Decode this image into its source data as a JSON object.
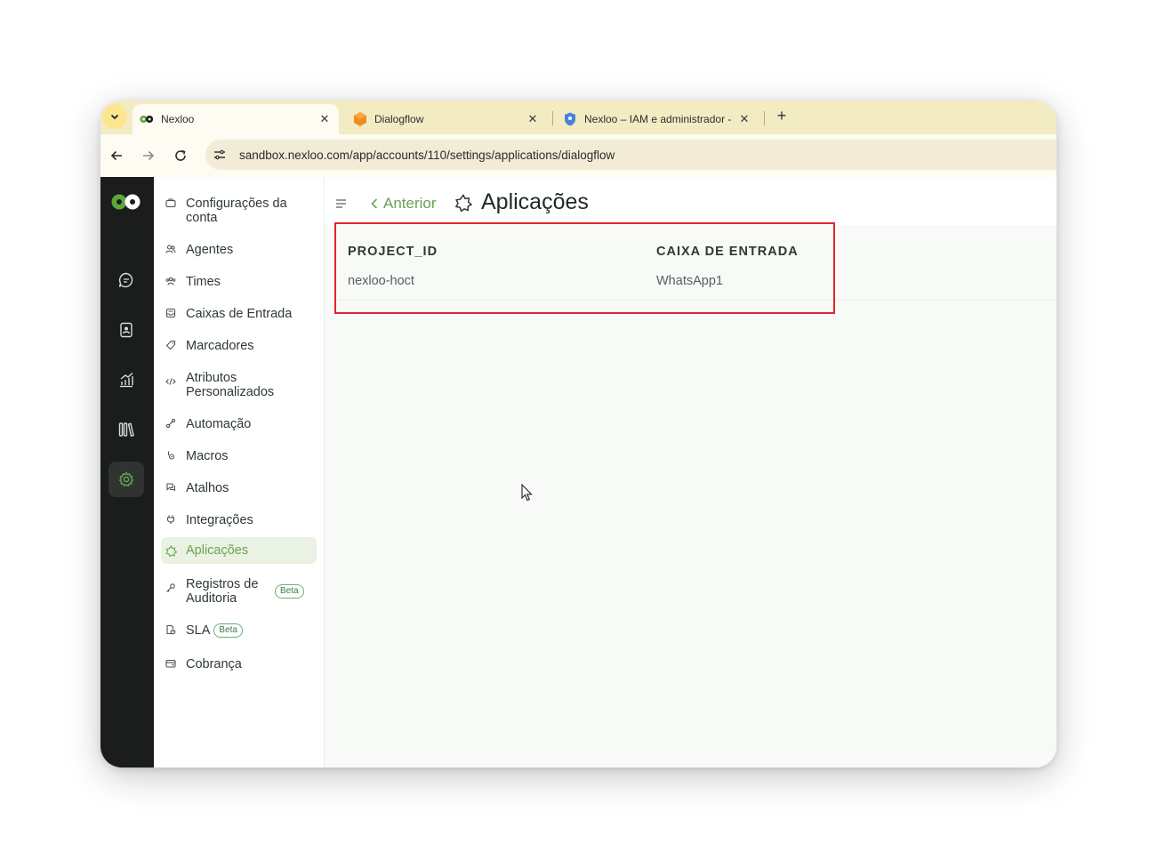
{
  "browser": {
    "tabs": [
      {
        "title": "Nexloo",
        "active": true,
        "favicon": "nexloo-logo-icon"
      },
      {
        "title": "Dialogflow",
        "active": false,
        "favicon": "dialogflow-icon"
      },
      {
        "title": "Nexloo – IAM e administrador -",
        "active": false,
        "favicon": "shield-icon"
      }
    ],
    "url": "sandbox.nexloo.com/app/accounts/110/settings/applications/dialogflow"
  },
  "rail": {
    "items": [
      "chat-icon",
      "contacts-icon",
      "reports-icon",
      "library-icon",
      "settings-gear-icon"
    ],
    "active": "settings-gear-icon"
  },
  "settings_nav": {
    "items": [
      {
        "label": "Configurações da conta",
        "icon": "briefcase-icon"
      },
      {
        "label": "Agentes",
        "icon": "users-icon"
      },
      {
        "label": "Times",
        "icon": "team-icon"
      },
      {
        "label": "Caixas de Entrada",
        "icon": "inbox-icon"
      },
      {
        "label": "Marcadores",
        "icon": "tag-icon"
      },
      {
        "label": "Atributos Personalizados",
        "icon": "code-icon"
      },
      {
        "label": "Automação",
        "icon": "automation-icon"
      },
      {
        "label": "Macros",
        "icon": "macro-icon"
      },
      {
        "label": "Atalhos",
        "icon": "chat-bubbles-icon"
      },
      {
        "label": "Integrações",
        "icon": "plug-icon"
      },
      {
        "label": "Aplicações",
        "icon": "star-badge-icon",
        "active": true
      },
      {
        "label": "Registros de Auditoria",
        "icon": "key-icon",
        "badge": "Beta"
      },
      {
        "label": "SLA",
        "icon": "document-clock-icon",
        "badge": "Beta"
      },
      {
        "label": "Cobrança",
        "icon": "wallet-icon"
      }
    ]
  },
  "header": {
    "back_label": "Anterior",
    "title": "Aplicações"
  },
  "table": {
    "columns": [
      "PROJECT_ID",
      "CAIXA DE ENTRADA"
    ],
    "rows": [
      [
        "nexloo-hoct",
        "WhatsApp1"
      ]
    ]
  },
  "colors": {
    "accent": "#6aa34f",
    "highlight_box": "#e0242c",
    "tabstrip": "#f3ebc2",
    "rail": "#1a1d1b"
  }
}
